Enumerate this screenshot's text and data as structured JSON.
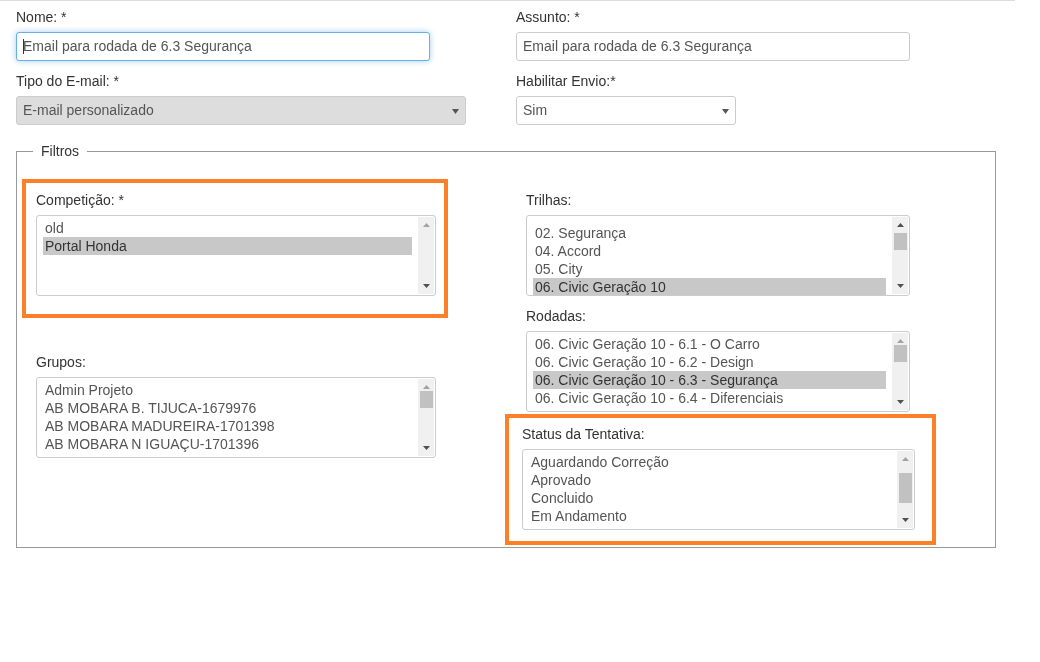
{
  "top_fields": [
    {
      "kind": "text",
      "label": "Nome: *",
      "value": "Email para rodada de 6.3 Segurança",
      "focused": true,
      "disabled": false
    },
    {
      "kind": "text",
      "label": "Assunto: *",
      "value": "Email para rodada de 6.3 Segurança",
      "focused": false,
      "disabled": false
    },
    {
      "kind": "select",
      "label": "Tipo do E-mail: *",
      "value": "E-mail personalizado",
      "focused": false,
      "disabled": true
    },
    {
      "kind": "select",
      "label": "Habilitar Envio:*",
      "value": "Sim",
      "focused": false,
      "disabled": false
    }
  ],
  "filtros": {
    "legend": "Filtros",
    "left": [
      {
        "label": "Competição: *",
        "highlighted": true,
        "items": [
          {
            "text": "old",
            "selected": false
          },
          {
            "text": "Portal Honda",
            "selected": true
          }
        ]
      },
      {
        "label": "Grupos:",
        "highlighted": false,
        "items": [
          {
            "text": "Admin Projeto",
            "selected": false
          },
          {
            "text": "AB MOBARA B. TIJUCA-1679976",
            "selected": false
          },
          {
            "text": "AB MOBARA MADUREIRA-1701398",
            "selected": false
          },
          {
            "text": "AB MOBARA N IGUAÇU-1701396",
            "selected": false
          }
        ]
      }
    ],
    "right": [
      {
        "label": "Trilhas:",
        "highlighted": false,
        "items": [
          {
            "text": "02. Segurança",
            "selected": false
          },
          {
            "text": "04. Accord",
            "selected": false
          },
          {
            "text": "05. City",
            "selected": false
          },
          {
            "text": "06. Civic Geração 10",
            "selected": true
          }
        ]
      },
      {
        "label": "Rodadas:",
        "highlighted": false,
        "items": [
          {
            "text": "06. Civic Geração 10 - 6.1 - O Carro",
            "selected": false
          },
          {
            "text": "06. Civic Geração 10 - 6.2 - Design",
            "selected": false
          },
          {
            "text": "06. Civic Geração 10 - 6.3 - Segurança",
            "selected": true
          },
          {
            "text": "06. Civic Geração 10 - 6.4 - Diferenciais",
            "selected": false
          }
        ]
      },
      {
        "label": "Status da Tentativa:",
        "highlighted": true,
        "items": [
          {
            "text": "Aguardando Correção",
            "selected": false
          },
          {
            "text": "Aprovado",
            "selected": false
          },
          {
            "text": "Concluido",
            "selected": false
          },
          {
            "text": "Em Andamento",
            "selected": false
          }
        ]
      }
    ]
  }
}
